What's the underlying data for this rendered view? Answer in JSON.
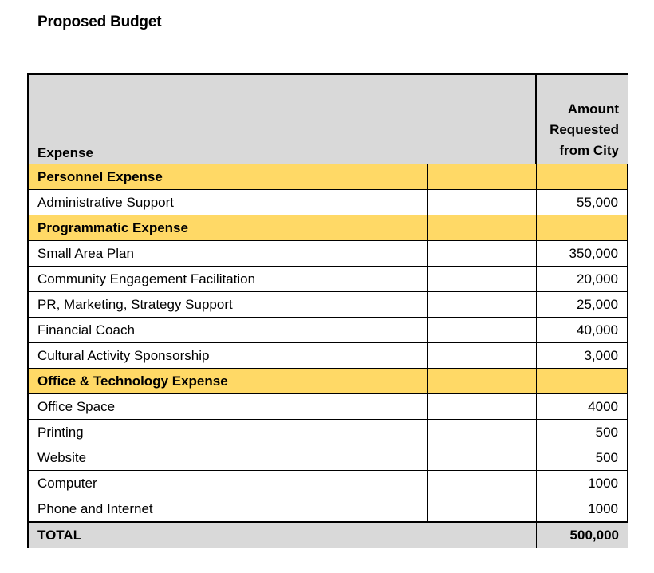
{
  "document": {
    "title": "Proposed Budget"
  },
  "table": {
    "header": {
      "expense": "Expense",
      "amount_line1": "Amount",
      "amount_line2": "Requested",
      "amount_line3": "from City"
    },
    "sections": [
      {
        "label": "Personnel Expense",
        "items": [
          {
            "name": "Administrative Support",
            "amount": "55,000"
          }
        ]
      },
      {
        "label": "Programmatic Expense",
        "items": [
          {
            "name": "Small Area Plan",
            "amount": "350,000"
          },
          {
            "name": "Community Engagement Facilitation",
            "amount": "20,000"
          },
          {
            "name": "PR, Marketing, Strategy Support",
            "amount": "25,000"
          },
          {
            "name": "Financial Coach",
            "amount": "40,000"
          },
          {
            "name": "Cultural Activity Sponsorship",
            "amount": "3,000"
          }
        ]
      },
      {
        "label": "Office & Technology Expense",
        "items": [
          {
            "name": "Office Space",
            "amount": "4000"
          },
          {
            "name": "Printing",
            "amount": "500"
          },
          {
            "name": "Website",
            "amount": "500"
          },
          {
            "name": "Computer",
            "amount": "1000"
          },
          {
            "name": "Phone and Internet",
            "amount": "1000"
          }
        ]
      }
    ],
    "total": {
      "label": "TOTAL",
      "amount": "500,000"
    }
  },
  "colors": {
    "header_bg": "#d9d9d9",
    "section_bg": "#ffd966",
    "total_bg": "#d9d9d9"
  }
}
